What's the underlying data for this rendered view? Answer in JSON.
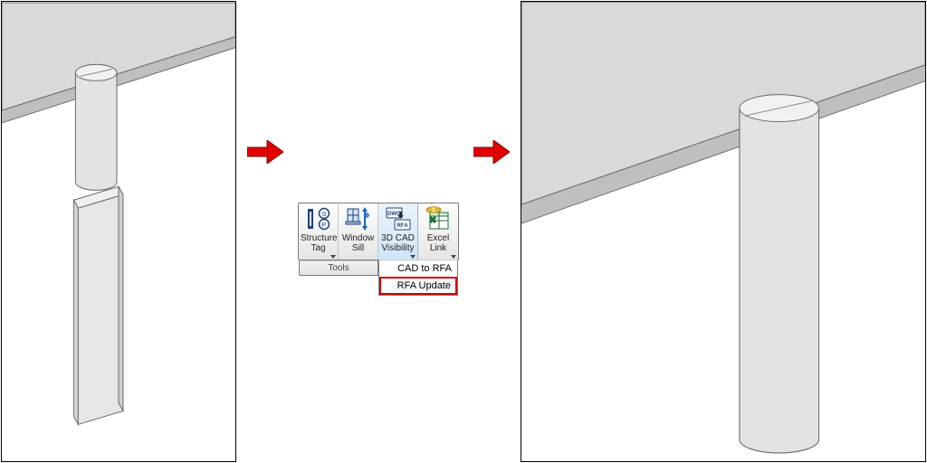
{
  "ribbon": {
    "panel_title": "Tools",
    "buttons": {
      "structure_tag": {
        "label": "Structure\nTag"
      },
      "window_sill": {
        "label": "Window\nSill"
      },
      "cad_visibility": {
        "label": "3D CAD\nVisibility"
      },
      "excel_link": {
        "label": "Excel\nLink"
      }
    },
    "menu": {
      "cad_to_rfa": "CAD to RFA",
      "rfa_update": "RFA Update"
    }
  }
}
